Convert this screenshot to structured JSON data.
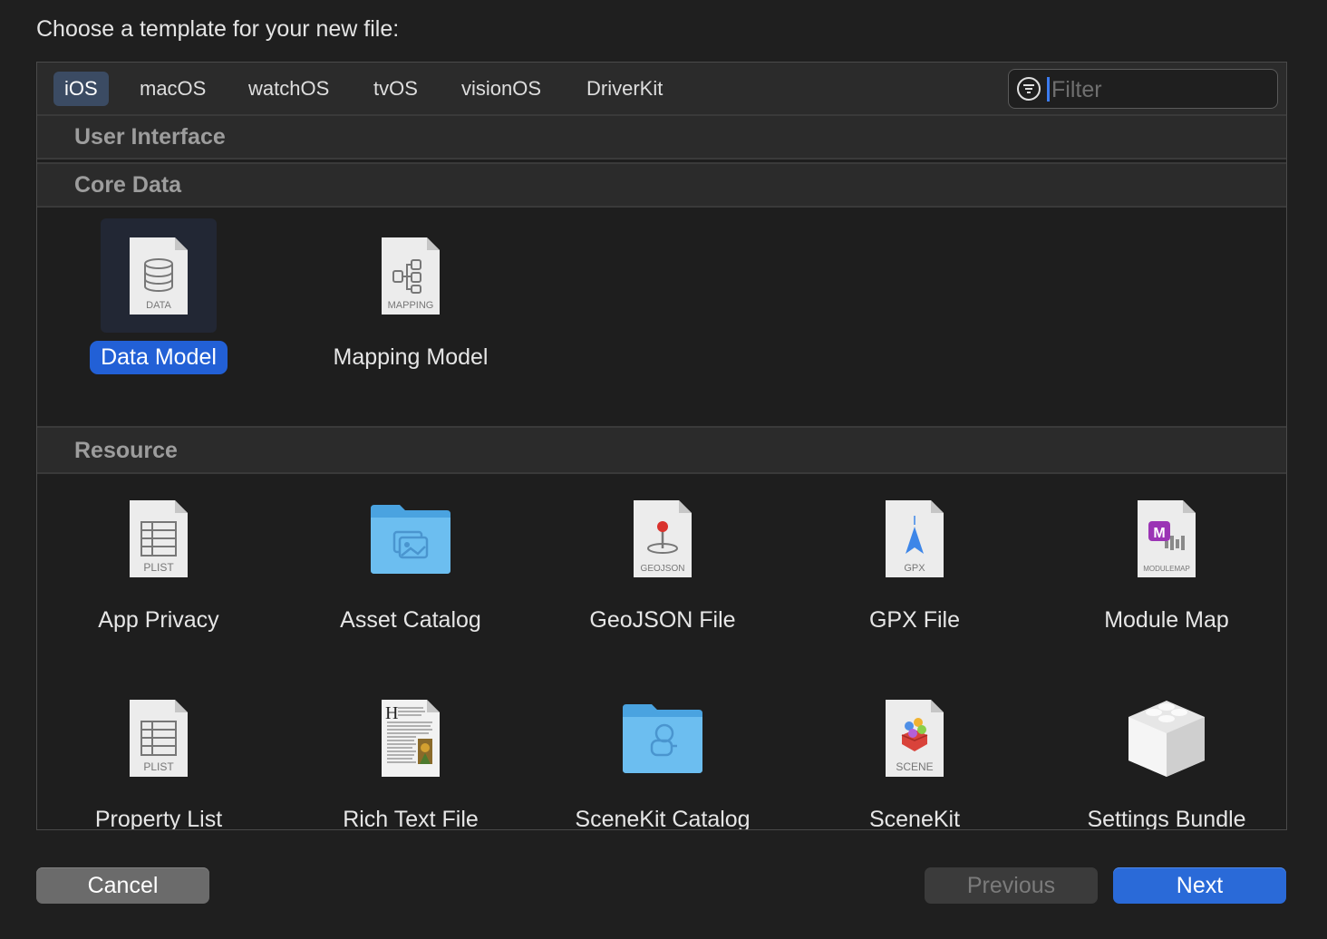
{
  "dialog": {
    "title": "Choose a template for your new file:"
  },
  "tabs": [
    {
      "label": "iOS",
      "active": true
    },
    {
      "label": "macOS"
    },
    {
      "label": "watchOS"
    },
    {
      "label": "tvOS"
    },
    {
      "label": "visionOS"
    },
    {
      "label": "DriverKit"
    }
  ],
  "filter": {
    "placeholder": "Filter",
    "value": ""
  },
  "sections": [
    {
      "title": "User Interface",
      "items": []
    },
    {
      "title": "Core Data",
      "items": [
        {
          "label": "Data Model",
          "icon": "data-model-icon",
          "icon_text": "DATA",
          "selected": true
        },
        {
          "label": "Mapping Model",
          "icon": "mapping-model-icon",
          "icon_text": "MAPPING"
        }
      ]
    },
    {
      "title": "Resource",
      "items": [
        {
          "label": "App Privacy",
          "icon": "plist-icon",
          "icon_text": "PLIST"
        },
        {
          "label": "Asset Catalog",
          "icon": "asset-folder-icon"
        },
        {
          "label": "GeoJSON File",
          "icon": "geojson-icon",
          "icon_text": "GEOJSON"
        },
        {
          "label": "GPX File",
          "icon": "gpx-icon",
          "icon_text": "GPX"
        },
        {
          "label": "Module Map",
          "icon": "modulemap-icon",
          "icon_text": "MODULEMAP"
        },
        {
          "label": "Property List",
          "icon": "plist-icon",
          "icon_text": "PLIST"
        },
        {
          "label": "Rich Text File",
          "icon": "rich-text-icon"
        },
        {
          "label": "SceneKit Catalog",
          "icon": "scenekit-folder-icon"
        },
        {
          "label": "SceneKit",
          "icon": "scene-icon",
          "icon_text": "SCENE"
        },
        {
          "label": "Settings Bundle",
          "icon": "lego-brick-icon"
        }
      ]
    }
  ],
  "buttons": {
    "cancel": "Cancel",
    "previous": "Previous",
    "next": "Next"
  },
  "colors": {
    "accent": "#2a6ad8",
    "selection": "#2260d6",
    "background": "#1f1f1f"
  }
}
